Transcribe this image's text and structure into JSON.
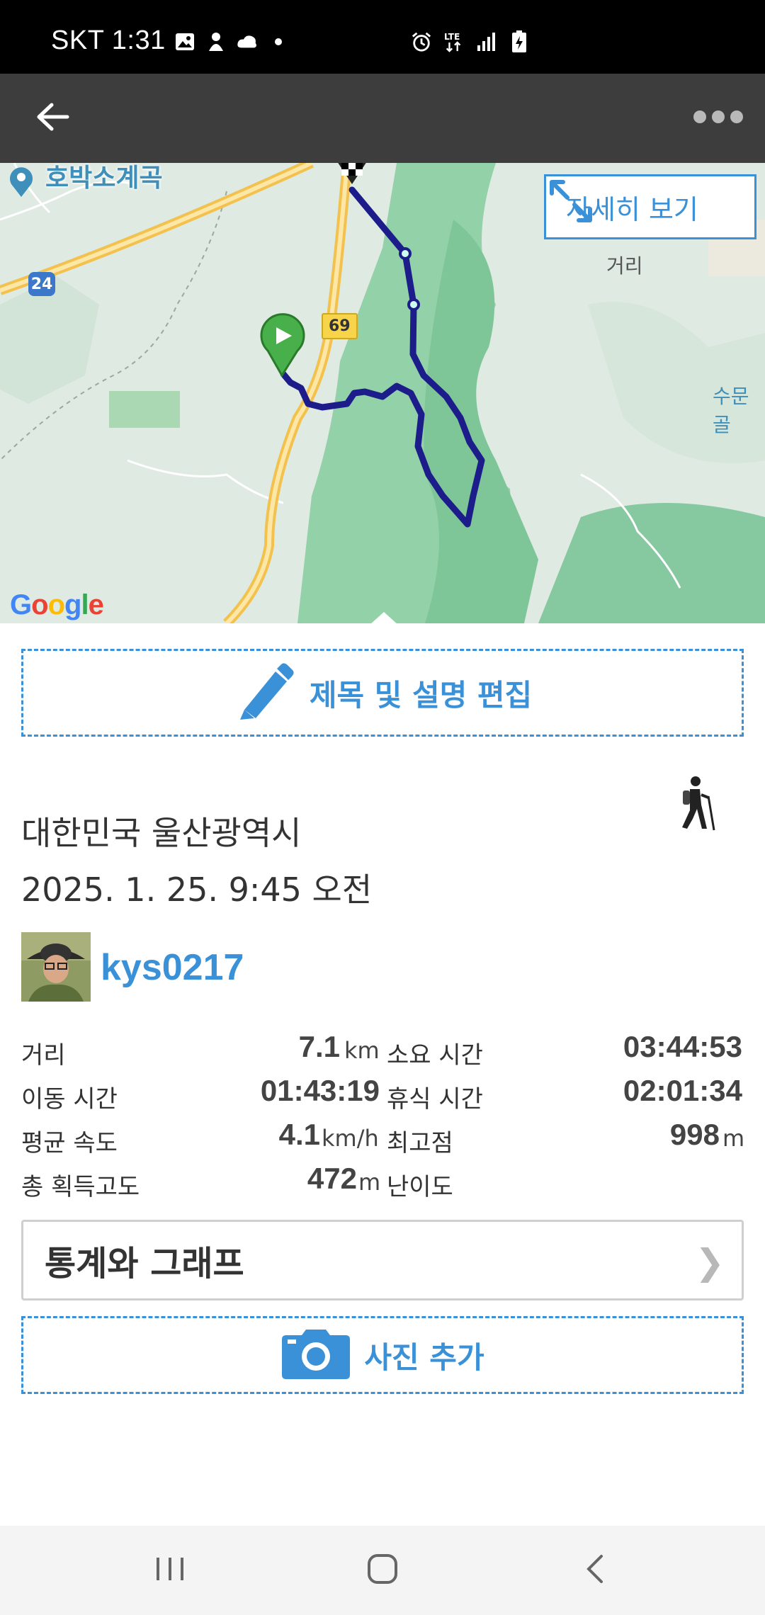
{
  "status_bar": {
    "carrier_time": "SKT 1:31",
    "left_icons": [
      "image-icon",
      "character-icon",
      "cloud-icon",
      "dot-icon"
    ],
    "right_icons": [
      "alarm-icon",
      "lte-icon",
      "signal-icon",
      "battery-charging-icon"
    ]
  },
  "app_bar": {
    "back_icon": "arrow-left-icon",
    "more_icon": "more-dots-icon"
  },
  "map": {
    "detail_button_label": "자세히 보기",
    "poi_label": "호박소계곡",
    "place_label_1": "거리",
    "place_label_2": "수문골",
    "road_69": "69",
    "road_24": "24",
    "logo_text": "Google",
    "colors": {
      "route": "#1c1c8a",
      "forest": "#7fc79a",
      "road": "#f2c14e"
    }
  },
  "edit_button": {
    "label": "제목 및 설명 편집",
    "icon": "pencil-icon"
  },
  "activity": {
    "location": "대한민국 울산광역시",
    "datetime": "2025. 1. 25. 9:45 오전",
    "type_icon": "hiking-icon"
  },
  "user": {
    "name": "kys0217"
  },
  "stats": {
    "distance_label": "거리",
    "distance_value": "7.1",
    "distance_unit": "km",
    "duration_label": "소요 시간",
    "duration_value": "03:44:53",
    "moving_time_label": "이동 시간",
    "moving_time_value": "01:43:19",
    "rest_time_label": "휴식 시간",
    "rest_time_value": "02:01:34",
    "avg_speed_label": "평균 속도",
    "avg_speed_value": "4.1",
    "avg_speed_unit": "km/h",
    "max_elev_label": "최고점",
    "max_elev_value": "998",
    "max_elev_unit": "m",
    "total_gain_label": "총 획득고도",
    "total_gain_value": "472",
    "total_gain_unit": "m",
    "difficulty_label": "난이도"
  },
  "stats_button": {
    "label": "통계와 그래프",
    "chevron": "❯"
  },
  "photo_button": {
    "label": "사진 추가",
    "icon": "camera-icon"
  },
  "nav_bar": {
    "icons": [
      "recent-apps-icon",
      "home-icon",
      "back-nav-icon"
    ]
  }
}
